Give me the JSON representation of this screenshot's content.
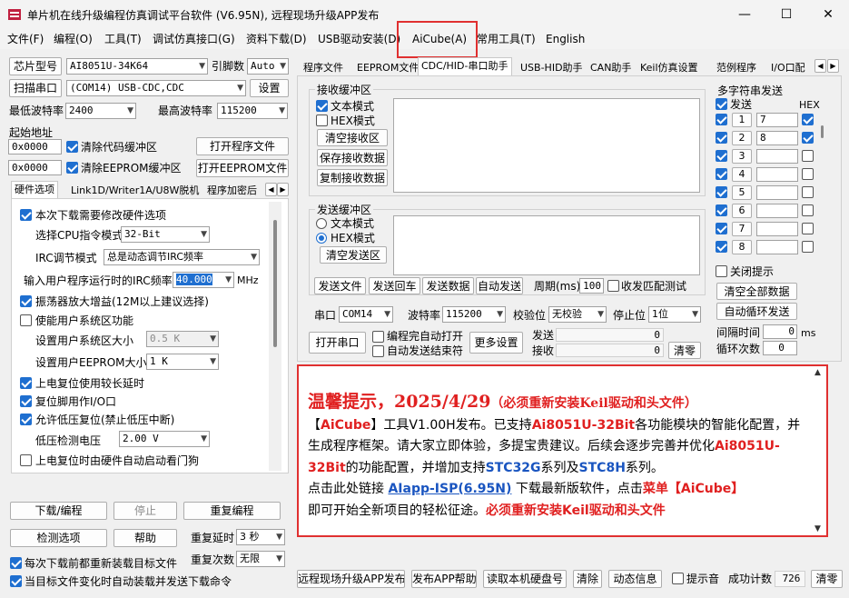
{
  "window": {
    "title": "单片机在线升级编程仿真调试平台软件 (V6.95N), 远程现场升级APP发布",
    "controls": {
      "minimize": "—",
      "maximize": "☐",
      "close": "✕"
    }
  },
  "menu": [
    "文件(F)",
    "编程(O)",
    "工具(T)",
    "调试仿真接口(G)",
    "资料下载(D)",
    "USB驱动安装(D)",
    "AiCube(A)",
    "常用工具(T)",
    "English"
  ],
  "left": {
    "chip_type_btn": "芯片型号",
    "chip_type_value": "AI8051U-34K64",
    "pin_count_label": "引脚数",
    "pin_count_value": "Auto",
    "scan_port_btn": "扫描串口",
    "port_value": "(COM14) USB-CDC,CDC",
    "settings_btn": "设置",
    "min_baud_label": "最低波特率",
    "min_baud_value": "2400",
    "max_baud_label": "最高波特率",
    "max_baud_value": "115200",
    "start_addr_label": "起始地址",
    "addr1": "0x0000",
    "clear_code_label": "清除代码缓冲区",
    "open_prog_btn": "打开程序文件",
    "addr2": "0x0000",
    "clear_eeprom_label": "清除EEPROM缓冲区",
    "open_eeprom_btn": "打开EEPROM文件",
    "tabs": [
      "硬件选项",
      "Link1D/Writer1A/U8W脱机",
      "程序加密后"
    ],
    "hw": {
      "need_modify": "本次下载需要修改硬件选项",
      "cpu_label": "选择CPU指令模式",
      "cpu_value": "32-Bit",
      "irc_mode_label": "IRC调节模式",
      "irc_mode_value": "总是动态调节IRC频率",
      "irc_freq_label": "输入用户程序运行时的IRC频率",
      "irc_freq_value": "40.000",
      "irc_freq_unit": "MHz",
      "osc_gain": "振荡器放大增益(12M以上建议选择)",
      "user_sys": "使能用户系统区功能",
      "user_sys_size_label": "设置用户系统区大小",
      "user_sys_size_value": "0.5 K",
      "user_eeprom_label": "设置用户EEPROM大小",
      "user_eeprom_value": "1   K",
      "power_delay": "上电复位使用较长延时",
      "reset_io": "复位脚用作I/O口",
      "lv_reset": "允许低压复位(禁止低压中断)",
      "lv_voltage_label": "低压检测电压",
      "lv_voltage_value": "2.00 V",
      "wdt": "上电复位时由硬件自动启动看门狗"
    },
    "download_btn": "下载/编程",
    "stop_btn": "停止",
    "reprogram_btn": "重复编程",
    "check_btn": "检测选项",
    "help_btn": "帮助",
    "repeat_delay_label": "重复延时",
    "repeat_delay_value": "3 秒",
    "repeat_count_label": "重复次数",
    "repeat_count_value": "无限",
    "reload_each": "每次下载前都重新装载目标文件",
    "auto_send": "当目标文件变化时自动装载并发送下载命令"
  },
  "right": {
    "tabs": [
      "程序文件",
      "EEPROM文件",
      "CDC/HID-串口助手",
      "USB-HID助手",
      "CAN助手",
      "Keil仿真设置",
      "范例程序",
      "I/O口配"
    ],
    "recv": {
      "title": "接收缓冲区",
      "text_mode": "文本模式",
      "hex_mode": "HEX模式",
      "clear_btn": "清空接收区",
      "save_btn": "保存接收数据",
      "copy_btn": "复制接收数据"
    },
    "send": {
      "title": "发送缓冲区",
      "text_mode": "文本模式",
      "hex_mode": "HEX模式",
      "clear_btn": "清空发送区",
      "send_file_btn": "发送文件",
      "send_back_btn": "发送回车",
      "send_data_btn": "发送数据",
      "auto_send_btn": "自动发送",
      "period_label": "周期(ms)",
      "period_value": "100",
      "match_label": "收发匹配测试"
    },
    "port_label": "串口",
    "port_value": "COM14",
    "baud_label": "波特率",
    "baud_value": "115200",
    "parity_label": "校验位",
    "parity_value": "无校验",
    "stop_label": "停止位",
    "stop_value": "1位",
    "open_port_btn": "打开串口",
    "prog_open_label": "编程完自动打开",
    "auto_send_end_label": "自动发送结束符",
    "more_btn": "更多设置",
    "tx_label": "发送",
    "tx_value": "0",
    "rx_label": "接收",
    "rx_value": "0",
    "clear_btn": "清零",
    "multi": {
      "title": "多字符串发送",
      "send_label": "发送",
      "hex_label": "HEX",
      "rows": [
        {
          "n": "1",
          "v": "7"
        },
        {
          "n": "2",
          "v": "8"
        },
        {
          "n": "3",
          "v": ""
        },
        {
          "n": "4",
          "v": ""
        },
        {
          "n": "5",
          "v": ""
        },
        {
          "n": "6",
          "v": ""
        },
        {
          "n": "7",
          "v": ""
        },
        {
          "n": "8",
          "v": ""
        }
      ],
      "close_tip": "关闭提示",
      "clear_all_btn": "清空全部数据",
      "auto_loop_btn": "自动循环发送",
      "interval_label": "间隔时间",
      "interval_value": "0",
      "interval_unit": "ms",
      "loop_label": "循环次数",
      "loop_value": "0"
    }
  },
  "notice": {
    "headline": "温馨提示，2025/4/29",
    "headline_note": "（必须重新安装Keil驱动和头文件）",
    "p1a": "【",
    "p1b": "AiCube",
    "p1c": "】工具V1.00H发布。已支持",
    "p1d": "Ai8051U-32Bit",
    "p1e": "各功能模块的智能化配置，并生成程序框架。请大家立即体验，多提宝贵建议。后续会逐步完善并优化",
    "p1f": "Ai8051U-32Bit",
    "p1g": "的功能配置，并增加支持",
    "p1h": "STC32G",
    "p1i": "系列及",
    "p1j": "STC8H",
    "p1k": "系列。",
    "p2a": "点击此处链接 ",
    "p2b": "AIapp-ISP(6.95N)",
    "p2c": " 下载最新版软件，点击",
    "p2d": "菜单【AiCube】",
    "p2e": "即可开始全新项目的轻松征途。",
    "p2f": "必须重新安装Keil驱动和头文件"
  },
  "bottom": {
    "remote_btn": "远程现场升级APP发布",
    "publish_help_btn": "发布APP帮助",
    "read_disk_btn": "读取本机硬盘号",
    "clear_btn": "清除",
    "dynamic_btn": "动态信息",
    "beep_label": "提示音",
    "success_label": "成功计数",
    "success_value": "726",
    "clear_count_btn": "清零"
  }
}
